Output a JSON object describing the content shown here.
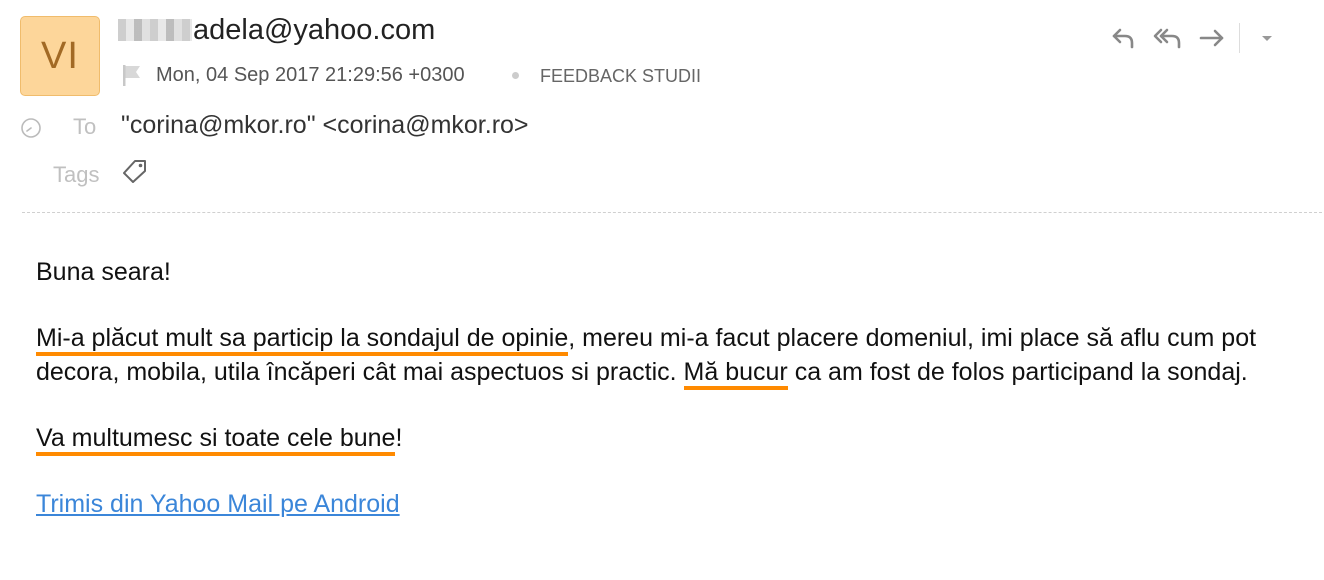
{
  "message": {
    "avatar_initials": "VI",
    "sender_visible": "adela@yahoo.com",
    "date": "Mon, 04 Sep 2017 21:29:56 +0300",
    "folder": "FEEDBACK STUDII",
    "to_label": "To",
    "to_value": "\"corina@mkor.ro\" <corina@mkor.ro>",
    "tags_label": "Tags"
  },
  "actions": {
    "reply_icon": "reply-icon",
    "reply_all_icon": "reply-all-icon",
    "forward_icon": "forward-icon",
    "more_icon": "chevron-down-icon"
  },
  "body": {
    "greeting": "Buna seara!",
    "p1_hl1": "Mi-a plăcut mult sa particip la sondajul de opinie",
    "p1_mid": ", mereu mi-a facut placere domeniul, imi place să aflu cum pot decora, mobila, utila încăperi cât mai aspectuos si practic. ",
    "p1_hl2": "Mă bucur",
    "p1_end": " ca am fost de folos participand la sondaj.",
    "p2_hl": "Va multumesc si toate cele bune",
    "p2_end": "!",
    "signature_link": "Trimis din Yahoo Mail pe Android"
  },
  "colors": {
    "avatar_bg": "#fdd69a",
    "highlight": "#ff8a00",
    "link": "#3b86d9"
  }
}
